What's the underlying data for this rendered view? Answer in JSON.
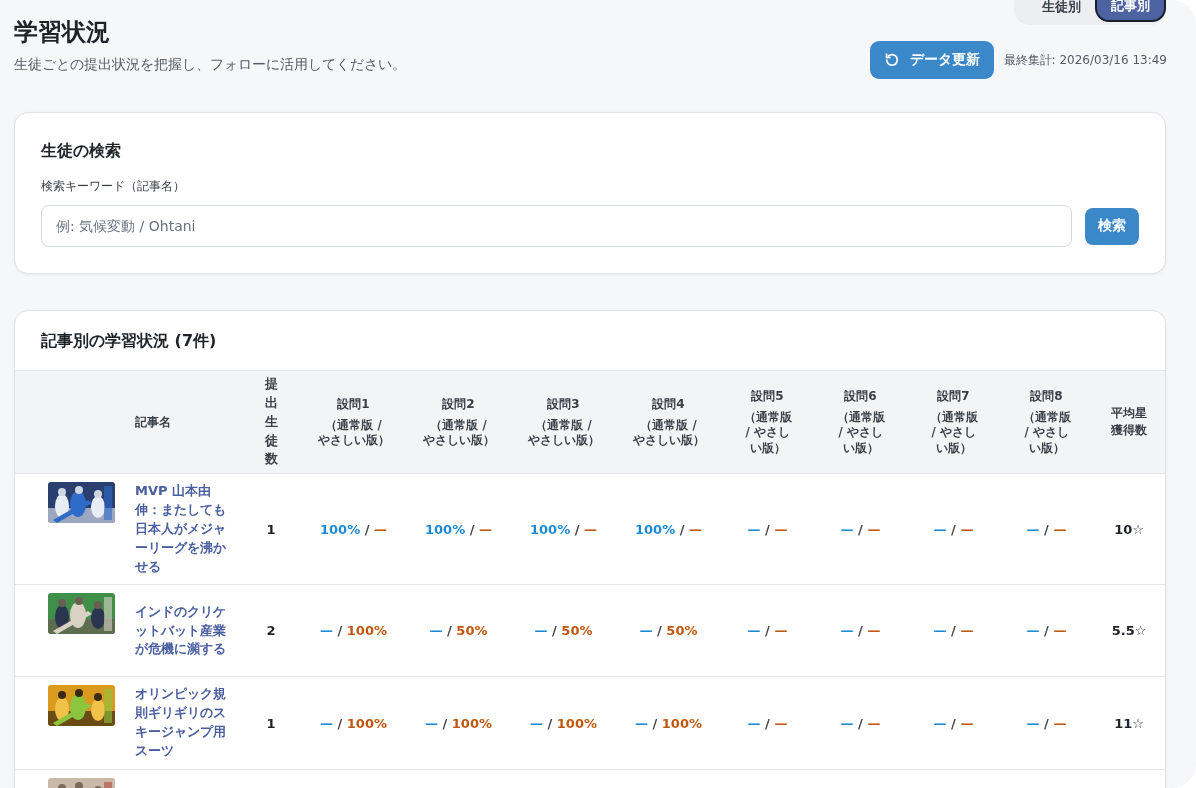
{
  "view_toggle": [
    {
      "label": "生徒別",
      "selected": false
    },
    {
      "label": "記事別",
      "selected": true
    }
  ],
  "header": {
    "title": "学習状況",
    "subtitle": "生徒ごとの提出状況を把握し、フォローに活用してください。",
    "refresh_button": "データ更新",
    "last_updated": "最終集計: 2026/03/16 13:49"
  },
  "search": {
    "title": "生徒の検索",
    "label": "検索キーワード（記事名）",
    "placeholder": "例: 気候変動 / Ohtani",
    "button": "検索"
  },
  "table": {
    "title": "記事別の学習状況 (7件)",
    "columns": [
      {
        "label": "記事名"
      },
      {
        "label": "提出生徒数",
        "kind": "vertical"
      },
      {
        "label": "設問1",
        "note": "（通常版 / やさしい版）"
      },
      {
        "label": "設問2",
        "note": "（通常版 / やさしい版）"
      },
      {
        "label": "設問3",
        "note": "（通常版 / やさしい版）"
      },
      {
        "label": "設問4",
        "note": "（通常版 / やさしい版）"
      },
      {
        "label": "設問5",
        "note": "（通常版 / やさしい版）"
      },
      {
        "label": "設問6",
        "note": "（通常版 / やさしい版）"
      },
      {
        "label": "設問7",
        "note": "（通常版 / やさしい版）"
      },
      {
        "label": "設問8",
        "note": "（通常版 / やさしい版）"
      },
      {
        "label": "平均星獲得数"
      }
    ],
    "rows": [
      {
        "thumbnail": {
          "kind": "picture"
        },
        "title": "MVP 山本由伸：またしても日本人がメジャーリーグを沸かせる",
        "submitted": "1",
        "questions": [
          {
            "normal": "100%",
            "sep": "/",
            "easy": "—"
          },
          {
            "normal": "100%",
            "sep": "/",
            "easy": "—"
          },
          {
            "normal": "100%",
            "sep": "/",
            "easy": "—"
          },
          {
            "normal": "100%",
            "sep": "/",
            "easy": "—"
          },
          {
            "normal": "—",
            "sep": "/",
            "easy": "—"
          },
          {
            "normal": "—",
            "sep": "/",
            "easy": "—"
          },
          {
            "normal": "—",
            "sep": "/",
            "easy": "—"
          },
          {
            "normal": "—",
            "sep": "/",
            "easy": "—"
          }
        ],
        "avg_stars": "10☆"
      },
      {
        "thumbnail": {
          "kind": "picture"
        },
        "title": "インドのクリケットバット産業が危機に瀕する",
        "submitted": "2",
        "questions": [
          {
            "normal": "—",
            "sep": "/",
            "easy": "100%"
          },
          {
            "normal": "—",
            "sep": "/",
            "easy": "50%"
          },
          {
            "normal": "—",
            "sep": "/",
            "easy": "50%"
          },
          {
            "normal": "—",
            "sep": "/",
            "easy": "50%"
          },
          {
            "normal": "—",
            "sep": "/",
            "easy": "—"
          },
          {
            "normal": "—",
            "sep": "/",
            "easy": "—"
          },
          {
            "normal": "—",
            "sep": "/",
            "easy": "—"
          },
          {
            "normal": "—",
            "sep": "/",
            "easy": "—"
          }
        ],
        "avg_stars": "5.5☆"
      },
      {
        "thumbnail": {
          "kind": "picture"
        },
        "title": "オリンピック規則ギリギリのスキージャンプ用スーツ",
        "submitted": "1",
        "questions": [
          {
            "normal": "—",
            "sep": "/",
            "easy": "100%"
          },
          {
            "normal": "—",
            "sep": "/",
            "easy": "100%"
          },
          {
            "normal": "—",
            "sep": "/",
            "easy": "100%"
          },
          {
            "normal": "—",
            "sep": "/",
            "easy": "100%"
          },
          {
            "normal": "—",
            "sep": "/",
            "easy": "—"
          },
          {
            "normal": "—",
            "sep": "/",
            "easy": "—"
          },
          {
            "normal": "—",
            "sep": "/",
            "easy": "—"
          },
          {
            "normal": "—",
            "sep": "/",
            "easy": "—"
          }
        ],
        "avg_stars": "11☆"
      },
      {
        "thumbnail": {
          "kind": "picture"
        }
      }
    ]
  }
}
